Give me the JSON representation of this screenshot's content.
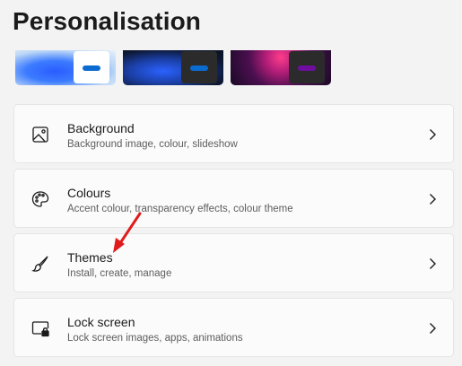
{
  "page": {
    "title": "Personalisation"
  },
  "theme_thumbnails": [
    {
      "name": "light-theme",
      "accent": "#0b6bd1"
    },
    {
      "name": "dark-bloom-theme",
      "accent": "#0b6bd1"
    },
    {
      "name": "glow-theme",
      "accent": "#6f0e9e"
    }
  ],
  "settings": {
    "items": [
      {
        "title": "Background",
        "subtitle": "Background image, colour, slideshow",
        "icon": "image-icon"
      },
      {
        "title": "Colours",
        "subtitle": "Accent colour, transparency effects, colour theme",
        "icon": "palette-icon"
      },
      {
        "title": "Themes",
        "subtitle": "Install, create, manage",
        "icon": "brush-icon"
      },
      {
        "title": "Lock screen",
        "subtitle": "Lock screen images, apps, animations",
        "icon": "lock-screen-icon"
      }
    ]
  },
  "colors": {
    "annotation_arrow": "#e01b1b",
    "card_background": "#fbfbfb",
    "page_background": "#f3f3f3"
  }
}
